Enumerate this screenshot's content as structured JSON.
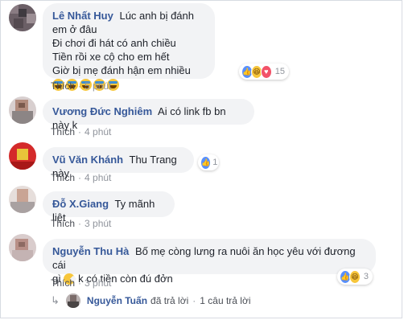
{
  "comments": [
    {
      "author": "Lê Nhất Huy",
      "lines": [
        "Lúc anh bị đánh em ở đâu",
        "Đi chơi đi hát có anh chiều",
        "Tiền rồi xe cộ cho em hết",
        "Giờ bị mẹ đánh hận em nhiều"
      ],
      "emoji_count": 5,
      "emoji_name": "crying-laughing-emoji",
      "like_label": "Thích",
      "time": "5 phút",
      "reactions": [
        "like-icon",
        "haha-icon",
        "love-icon"
      ],
      "reaction_count": "15"
    },
    {
      "author": "Vương Đức Nghiêm",
      "text": "Ai có link fb bn này k",
      "like_label": "Thích",
      "time": "4 phút"
    },
    {
      "author": "Vũ Văn Khánh",
      "text": "Thu Trang này",
      "like_label": "Thích",
      "time": "4 phút",
      "reactions": [
        "like-icon"
      ],
      "reaction_count": "1"
    },
    {
      "author": "Đỗ X.Giang",
      "text": "Ty mãnh liệt",
      "like_label": "Thích",
      "time": "3 phút"
    },
    {
      "author": "Nguyễn Thu Hà",
      "text_line1": "Bố mẹ còng lưng ra nuôi ăn học yêu với đương cái",
      "text_line2_pre": "gì",
      "text_line2_post": " k có tiền còn đú đởn",
      "like_label": "Thích",
      "time": "3 phút",
      "reactions": [
        "like-icon",
        "haha-icon"
      ],
      "reaction_count": "3"
    }
  ],
  "reply_summary": {
    "name": "Nguyễn Tuấn",
    "text": "đã trả lời",
    "separator": "·",
    "count_text": "1 câu trả lời"
  },
  "colors": {
    "link": "#365899",
    "bubble": "#f2f3f5",
    "meta": "#90949c",
    "like_blue": "#5890ff",
    "haha_yellow": "#f7c63b",
    "love_red": "#f25268"
  }
}
